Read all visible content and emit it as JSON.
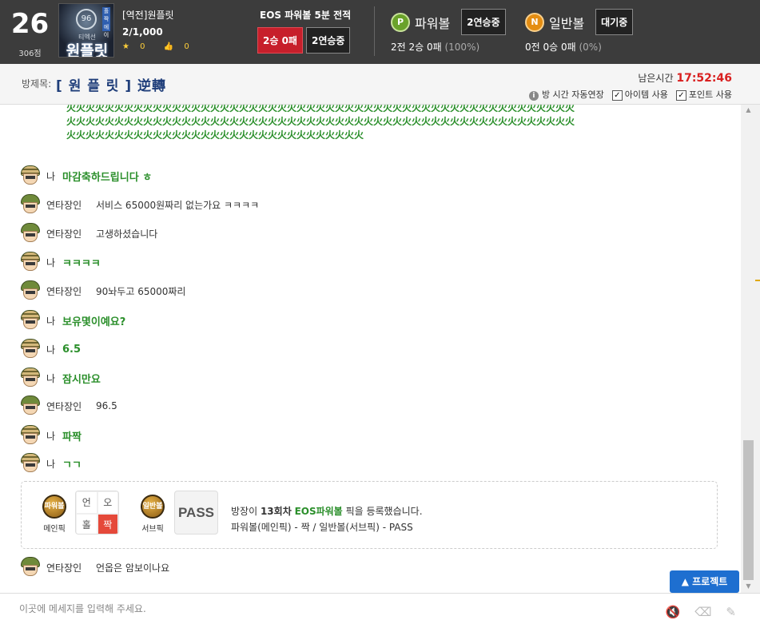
{
  "user": {
    "level": "26",
    "points": "306점"
  },
  "room": {
    "thumb_small": "티엑선",
    "thumb_big": "원플릿",
    "thumb_badge": "홀짝 에이",
    "thumb_circle": "96",
    "title": "[역전]원플릿",
    "count": "2/1,000",
    "stars": "0",
    "likes": "0"
  },
  "eos": {
    "title": "EOS 파워볼 5분 전적",
    "record": "2승 0패",
    "streak": "2연승중"
  },
  "powerball": {
    "badge": "P",
    "name": "파워볼",
    "status": "2연승중",
    "stat_main": "2전 2승 0패",
    "stat_pct": "(100%)"
  },
  "normalball": {
    "badge": "N",
    "name": "일반볼",
    "status": "대기중",
    "stat_main": "0전 0승 0패",
    "stat_pct": "(0%)"
  },
  "subbar": {
    "room_label": "방제목:",
    "room_name": "[ 원 플 릿 ] 逆轉",
    "time_label": "남은시간",
    "time_value": "17:52:46",
    "auto_extend": "방 시간 자동연장",
    "item_use": "아이템 사용",
    "point_use": "포인트 사용"
  },
  "chat": {
    "lol_text": "火火火火火火火火火火火火火火火火火火火火火火火火火火火火火火火火火火火火火火火火火火火火火火火火火火火火火火火火火火火火火火火火火火火火火火火火火火火火火火火火火火火火火火火火火火火火火火火火火火火火火火火火火火火火火火火火火火火火火火火火火火火火火火火火火火火火火火火火火",
    "messages": [
      {
        "nick": "나",
        "text": "마감축하드립니다 ㅎ",
        "me": true
      },
      {
        "nick": "연타장인",
        "text": "서비스 65000원짜리 없는가요 ㅋㅋㅋㅋ",
        "me": false
      },
      {
        "nick": "연타장인",
        "text": "고생하셨습니다",
        "me": false
      },
      {
        "nick": "나",
        "text": "ㅋㅋㅋㅋ",
        "me": true
      },
      {
        "nick": "연타장인",
        "text": "90놔두고 65000짜리",
        "me": false
      },
      {
        "nick": "나",
        "text": "보유몇이예요?",
        "me": true
      },
      {
        "nick": "나",
        "text": "6.5",
        "me": true
      },
      {
        "nick": "나",
        "text": "잠시만요",
        "me": true
      },
      {
        "nick": "연타장인",
        "text": "96.5",
        "me": false
      },
      {
        "nick": "나",
        "text": "파짝",
        "me": true
      },
      {
        "nick": "나",
        "text": "ㄱㄱ",
        "me": true
      }
    ],
    "last": {
      "nick": "연타장인",
      "text": "언옵은 암보이나요"
    }
  },
  "pick": {
    "main_ball": "파워볼",
    "main_label": "메인픽",
    "grid": [
      "언",
      "오",
      "홀",
      "짝"
    ],
    "sub_ball": "일반볼",
    "sub_label": "서브픽",
    "pass": "PASS",
    "line1_pre": "방장이",
    "line1_round": "13회차",
    "line1_game": "EOS파워볼",
    "line1_post": "픽을 등록했습니다.",
    "line2": "파워볼(메인픽) - 짝 / 일반볼(서브픽) - PASS"
  },
  "project_button": "▲ 프로젝트",
  "input": {
    "placeholder": "이곳에 메세지를 입력해 주세요."
  },
  "colors": {
    "accent_green": "#2b8f2b",
    "red": "#c71f2b",
    "blue": "#1e6fd0"
  }
}
